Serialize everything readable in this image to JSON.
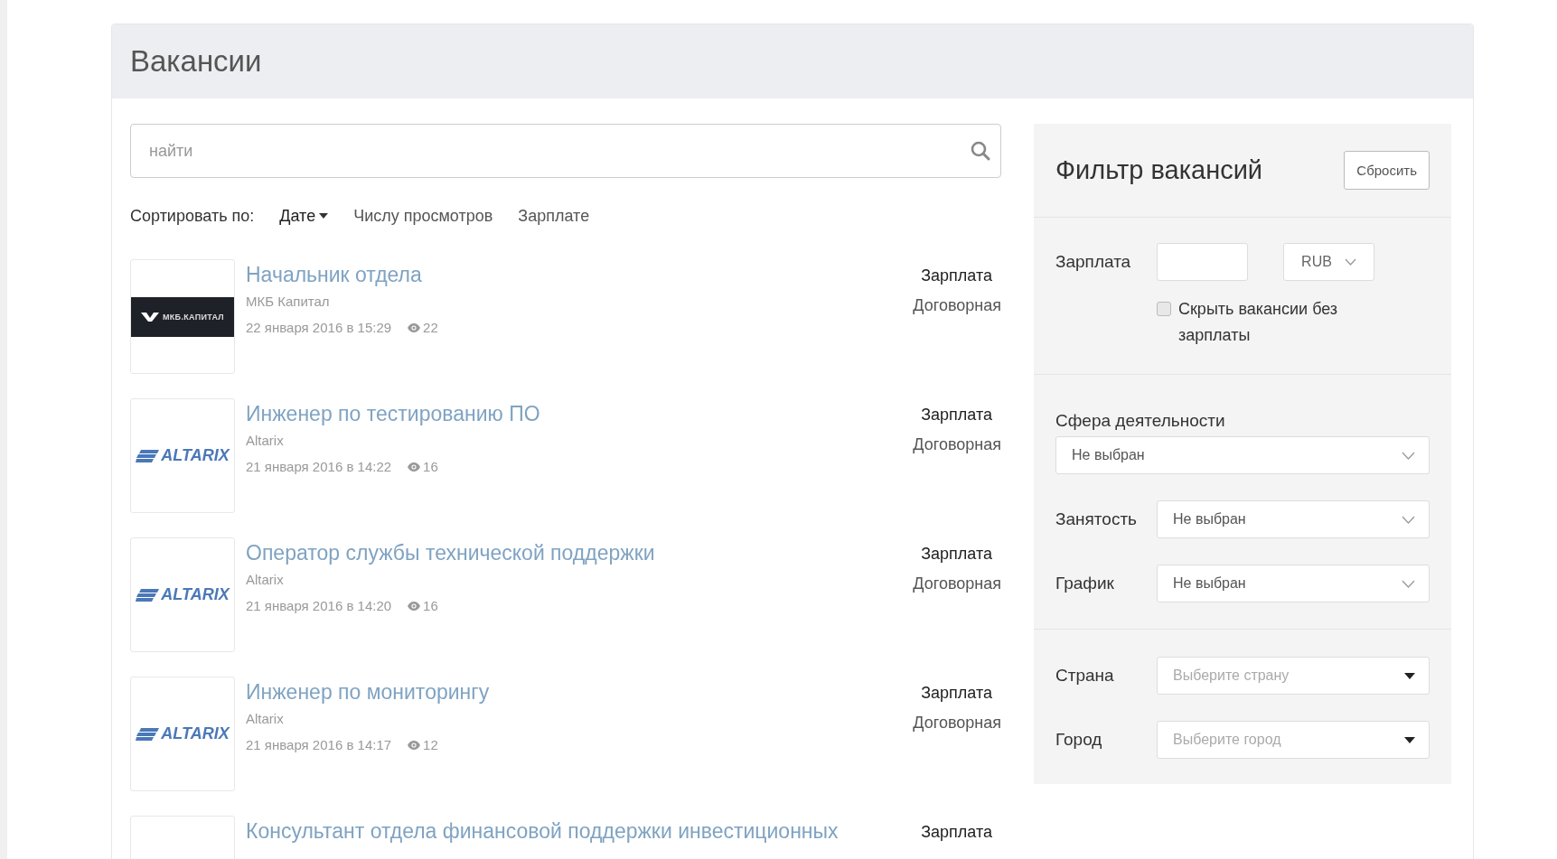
{
  "page": {
    "title": "Вакансии"
  },
  "search": {
    "placeholder": "найти"
  },
  "sort": {
    "label": "Сортировать по:",
    "options": [
      {
        "label": "Дате",
        "selected": true
      },
      {
        "label": "Числу просмотров",
        "selected": false
      },
      {
        "label": "Зарплате",
        "selected": false
      }
    ]
  },
  "vacancies": [
    {
      "title": "Начальник отдела",
      "company": "МКБ Капитал",
      "date": "22 января 2016 в 15:29",
      "views": "22",
      "salary_label": "Зарплата",
      "salary": "Договорная",
      "logo": {
        "kind": "mkb",
        "text": "МКБ.КАПИТАЛ"
      }
    },
    {
      "title": "Инженер по тестированию ПО",
      "company": "Altarix",
      "date": "21 января 2016 в 14:22",
      "views": "16",
      "salary_label": "Зарплата",
      "salary": "Договорная",
      "logo": {
        "kind": "altarix",
        "text": "ALTARIX"
      }
    },
    {
      "title": "Оператор службы технической поддержки",
      "company": "Altarix",
      "date": "21 января 2016 в 14:20",
      "views": "16",
      "salary_label": "Зарплата",
      "salary": "Договорная",
      "logo": {
        "kind": "altarix",
        "text": "ALTARIX"
      }
    },
    {
      "title": "Инженер по мониторингу",
      "company": "Altarix",
      "date": "21 января 2016 в 14:17",
      "views": "12",
      "salary_label": "Зарплата",
      "salary": "Договорная",
      "logo": {
        "kind": "altarix",
        "text": "ALTARIX"
      }
    },
    {
      "title": "Консультант отдела финансовой поддержки инвестиционных",
      "salary_label": "Зарплата",
      "logo": {
        "kind": "blank"
      }
    }
  ],
  "filter": {
    "title": "Фильтр вакансий",
    "reset": "Сбросить",
    "salary": {
      "label": "Зарплата",
      "currency": "RUB",
      "hide_without_salary": {
        "label": "Скрыть вакансии без зарплаты",
        "checked": false
      }
    },
    "sphere": {
      "label": "Сфера деятельности",
      "value": "Не выбран"
    },
    "selects": [
      {
        "label": "Занятость",
        "value": "Не выбран"
      },
      {
        "label": "График",
        "value": "Не выбран"
      }
    ],
    "location": [
      {
        "label": "Страна",
        "placeholder": "Выберите страну"
      },
      {
        "label": "Город",
        "placeholder": "Выберите город"
      }
    ]
  }
}
